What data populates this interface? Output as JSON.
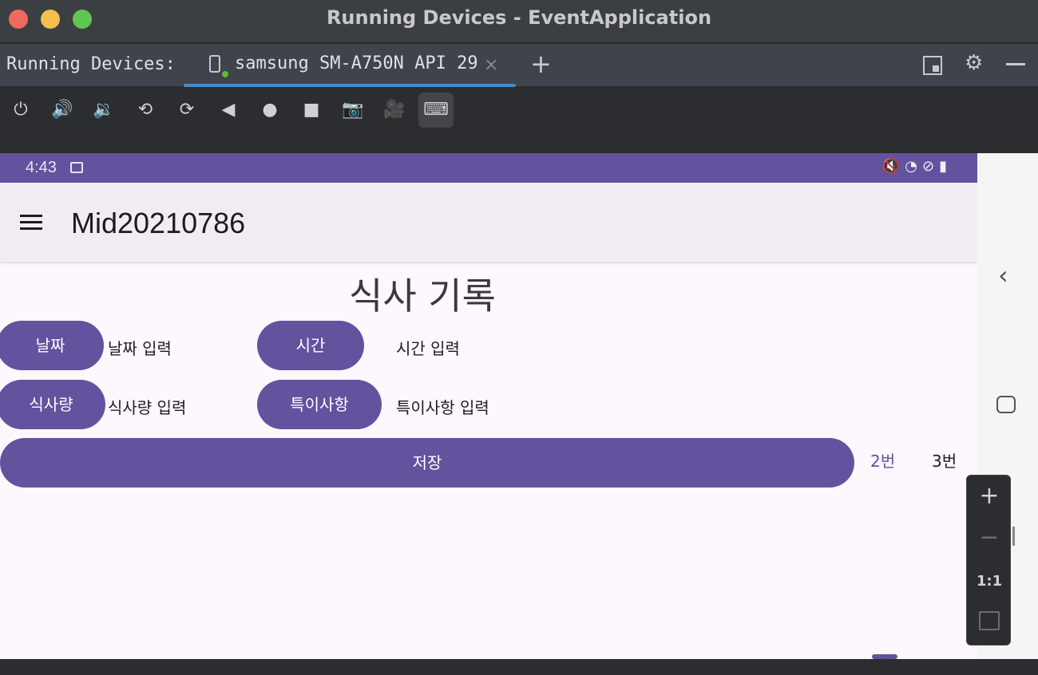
{
  "window": {
    "title": "Running Devices - EventApplication"
  },
  "tabbar": {
    "label": "Running Devices:",
    "device_tab": "samsung SM-A750N API 29",
    "close_glyph": "×",
    "add_glyph": "+"
  },
  "toolbar": {
    "icons": [
      "power-icon",
      "volume-up-icon",
      "volume-down-icon",
      "rotate-left-icon",
      "rotate-right-icon",
      "back-icon",
      "home-icon",
      "overview-icon",
      "screenshot-icon",
      "screen-record-icon",
      "keyboard-icon"
    ]
  },
  "status_bar": {
    "time": "4:43"
  },
  "app_bar": {
    "title": "Mid20210786"
  },
  "form": {
    "heading": "식사 기록",
    "date_button": "날짜",
    "date_field": "날짜 입력",
    "time_button": "시간",
    "time_field": "시간 입력",
    "amount_button": "식사량",
    "amount_field": "식사량 입력",
    "notes_button": "특이사항",
    "notes_field": "특이사항 입력",
    "save_button": "저장",
    "tab2": "2번",
    "tab3": "3번"
  },
  "zoom": {
    "plus": "+",
    "minus": "−",
    "one_to_one": "1:1"
  },
  "colors": {
    "accent": "#63529e",
    "screen_bg": "#fdf7fe",
    "appbar_bg": "#f1ecf4"
  }
}
